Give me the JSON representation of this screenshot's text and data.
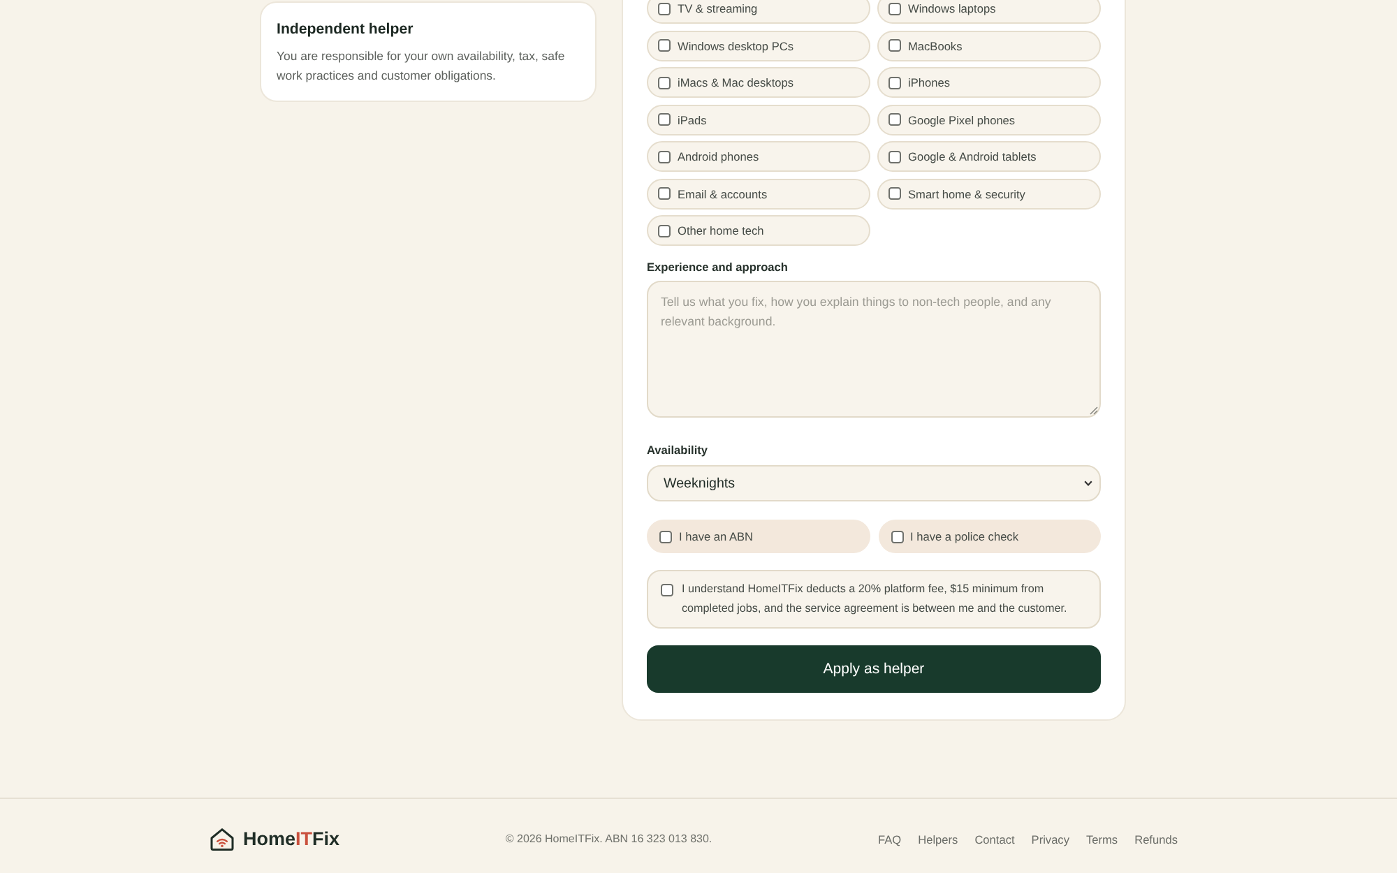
{
  "sidebar_card": {
    "title": "Independent helper",
    "text": "You are responsible for your own availability, tax, safe work practices and customer obligations."
  },
  "form": {
    "services": [
      {
        "label": "TV & streaming",
        "checked": false
      },
      {
        "label": "Windows laptops",
        "checked": false
      },
      {
        "label": "Windows desktop PCs",
        "checked": false
      },
      {
        "label": "MacBooks",
        "checked": false
      },
      {
        "label": "iMacs & Mac desktops",
        "checked": false
      },
      {
        "label": "iPhones",
        "checked": false
      },
      {
        "label": "iPads",
        "checked": false
      },
      {
        "label": "Google Pixel phones",
        "checked": false
      },
      {
        "label": "Android phones",
        "checked": false
      },
      {
        "label": "Google & Android tablets",
        "checked": false
      },
      {
        "label": "Email & accounts",
        "checked": false
      },
      {
        "label": "Smart home & security",
        "checked": false
      },
      {
        "label": "Other home tech",
        "checked": false
      }
    ],
    "experience": {
      "label": "Experience and approach",
      "placeholder": "Tell us what you fix, how you explain things to non-tech people, and any relevant background."
    },
    "availability": {
      "label": "Availability",
      "value": "Weeknights"
    },
    "confirmations": [
      {
        "label": "I have an ABN",
        "checked": false
      },
      {
        "label": "I have a police check",
        "checked": false
      }
    ],
    "agreement": {
      "text": "I understand HomeITFix deducts a 20% platform fee, $15 minimum from completed jobs, and the service agreement is between me and the customer.",
      "checked": false
    },
    "submit_button": "Apply as helper"
  },
  "footer": {
    "logo": {
      "prefix": "Home",
      "accent": "IT",
      "suffix": "Fix"
    },
    "copyright": "© 2026 HomeITFix. ABN 16 323 013 830.",
    "links": [
      "FAQ",
      "Helpers",
      "Contact",
      "Privacy",
      "Terms",
      "Refunds"
    ]
  }
}
